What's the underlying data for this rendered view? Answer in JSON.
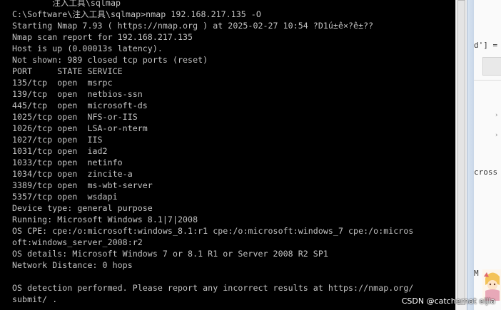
{
  "console": {
    "top_partial_line": "        注入工具\\sqlmap",
    "lines": [
      "C:\\Software\\注入工具\\sqlmap>nmap 192.168.217.135 -O",
      "Starting Nmap 7.93 ( https://nmap.org ) at 2025-02-27 10:54 ?D1ú±ê×?ê±??",
      "Nmap scan report for 192.168.217.135",
      "Host is up (0.00013s latency).",
      "Not shown: 989 closed tcp ports (reset)",
      "PORT     STATE SERVICE",
      "135/tcp  open  msrpc",
      "139/tcp  open  netbios-ssn",
      "445/tcp  open  microsoft-ds",
      "1025/tcp open  NFS-or-IIS",
      "1026/tcp open  LSA-or-nterm",
      "1027/tcp open  IIS",
      "1031/tcp open  iad2",
      "1033/tcp open  netinfo",
      "1034/tcp open  zincite-a",
      "3389/tcp open  ms-wbt-server",
      "5357/tcp open  wsdapi",
      "Device type: general purpose",
      "Running: Microsoft Windows 8.1|7|2008",
      "OS CPE: cpe:/o:microsoft:windows_8.1:r1 cpe:/o:microsoft:windows_7 cpe:/o:micros",
      "oft:windows_server_2008:r2",
      "OS details: Microsoft Windows 7 or 8.1 R1 or Server 2008 R2 SP1",
      "Network Distance: 0 hops",
      "",
      "OS detection performed. Please report any incorrect results at https://nmap.org/",
      "submit/ ."
    ]
  },
  "background_editor": {
    "snippet_top": "d'] =",
    "snippet_mid": "cross",
    "snippet_bottom": "M"
  },
  "watermark": {
    "text": "CSDN @catchernat eijia"
  },
  "colors": {
    "console_bg": "#000000",
    "console_fg": "#c4c4c4"
  }
}
